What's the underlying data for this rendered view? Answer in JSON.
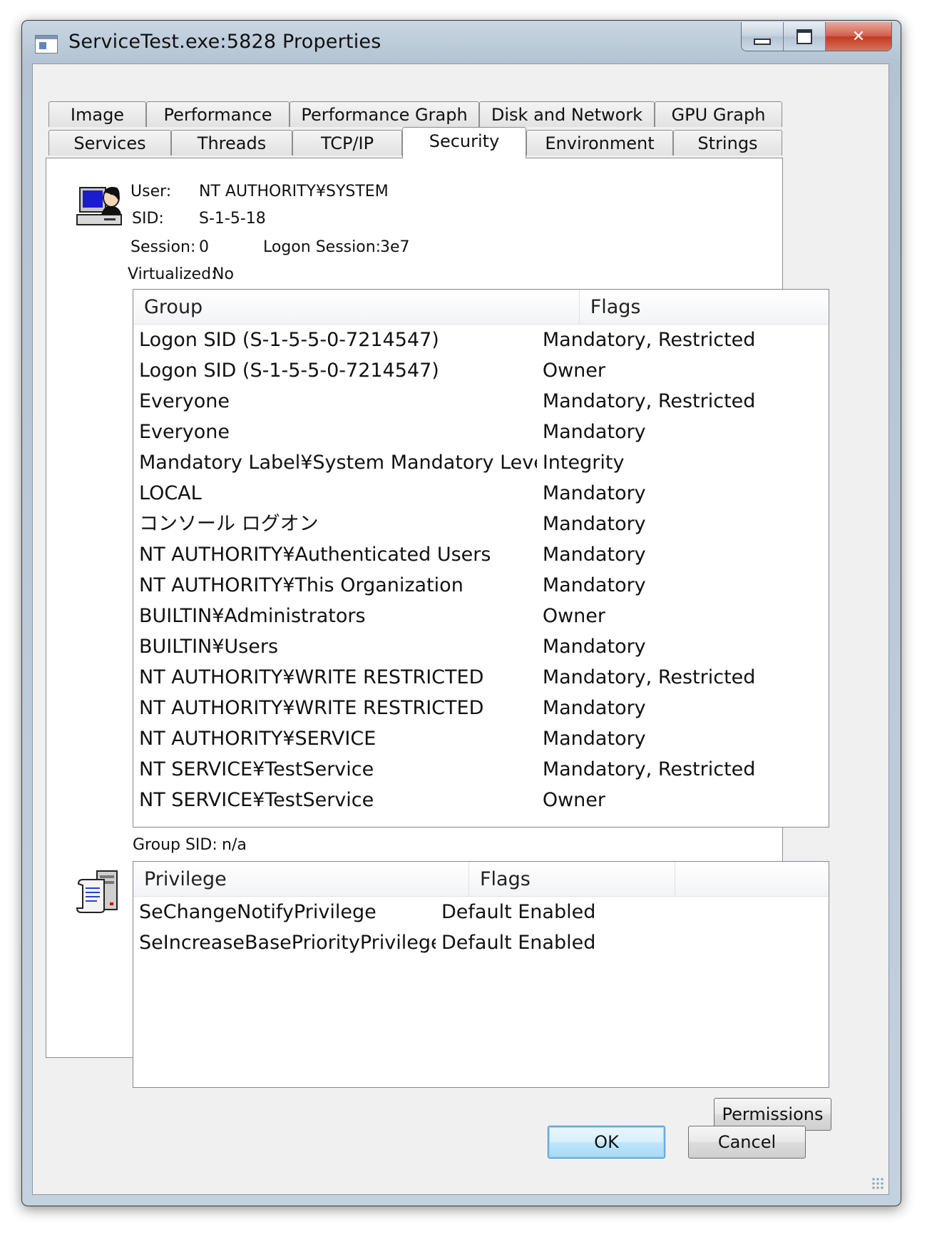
{
  "window": {
    "title": "ServiceTest.exe:5828 Properties",
    "caption_minimize": "",
    "caption_maximize": "",
    "caption_close": "✕"
  },
  "tabs": {
    "row1": [
      "Image",
      "Performance",
      "Performance Graph",
      "Disk and Network",
      "GPU Graph"
    ],
    "row2": [
      "Services",
      "Threads",
      "TCP/IP",
      "Security",
      "Environment",
      "Strings"
    ],
    "active": "Security"
  },
  "security": {
    "user_label": "User:",
    "user_value": "NT AUTHORITY¥SYSTEM",
    "sid_label": "SID:",
    "sid_value": "S-1-5-18",
    "session_label": "Session:",
    "session_value": "0",
    "logon_session_label": "Logon Session:",
    "logon_session_value": "3e7",
    "virtualized_label": "Virtualized:",
    "virtualized_value": "No",
    "group_sid_label": "Group SID:",
    "group_sid_value": "n/a"
  },
  "groups_table": {
    "columns": [
      "Group",
      "Flags"
    ],
    "rows": [
      [
        "Logon SID (S-1-5-5-0-7214547)",
        "Mandatory, Restricted"
      ],
      [
        "Logon SID (S-1-5-5-0-7214547)",
        "Owner"
      ],
      [
        "Everyone",
        "Mandatory, Restricted"
      ],
      [
        "Everyone",
        "Mandatory"
      ],
      [
        "Mandatory Label¥System Mandatory Level",
        "Integrity"
      ],
      [
        "LOCAL",
        "Mandatory"
      ],
      [
        "コンソール ログオン",
        "Mandatory"
      ],
      [
        "NT AUTHORITY¥Authenticated Users",
        "Mandatory"
      ],
      [
        "NT AUTHORITY¥This Organization",
        "Mandatory"
      ],
      [
        "BUILTIN¥Administrators",
        "Owner"
      ],
      [
        "BUILTIN¥Users",
        "Mandatory"
      ],
      [
        "NT AUTHORITY¥WRITE RESTRICTED",
        "Mandatory, Restricted"
      ],
      [
        "NT AUTHORITY¥WRITE RESTRICTED",
        "Mandatory"
      ],
      [
        "NT AUTHORITY¥SERVICE",
        "Mandatory"
      ],
      [
        "NT SERVICE¥TestService",
        "Mandatory, Restricted"
      ],
      [
        "NT SERVICE¥TestService",
        "Owner"
      ]
    ]
  },
  "privileges_table": {
    "columns": [
      "Privilege",
      "Flags",
      ""
    ],
    "rows": [
      [
        "SeChangeNotifyPrivilege",
        "Default Enabled"
      ],
      [
        "SeIncreaseBasePriorityPrivilege",
        "Default Enabled"
      ]
    ]
  },
  "buttons": {
    "permissions": "Permissions",
    "ok": "OK",
    "cancel": "Cancel"
  },
  "icons": {
    "title": "window-app-icon",
    "user": "user-at-computer-icon",
    "privileges": "scroll-server-icon"
  }
}
